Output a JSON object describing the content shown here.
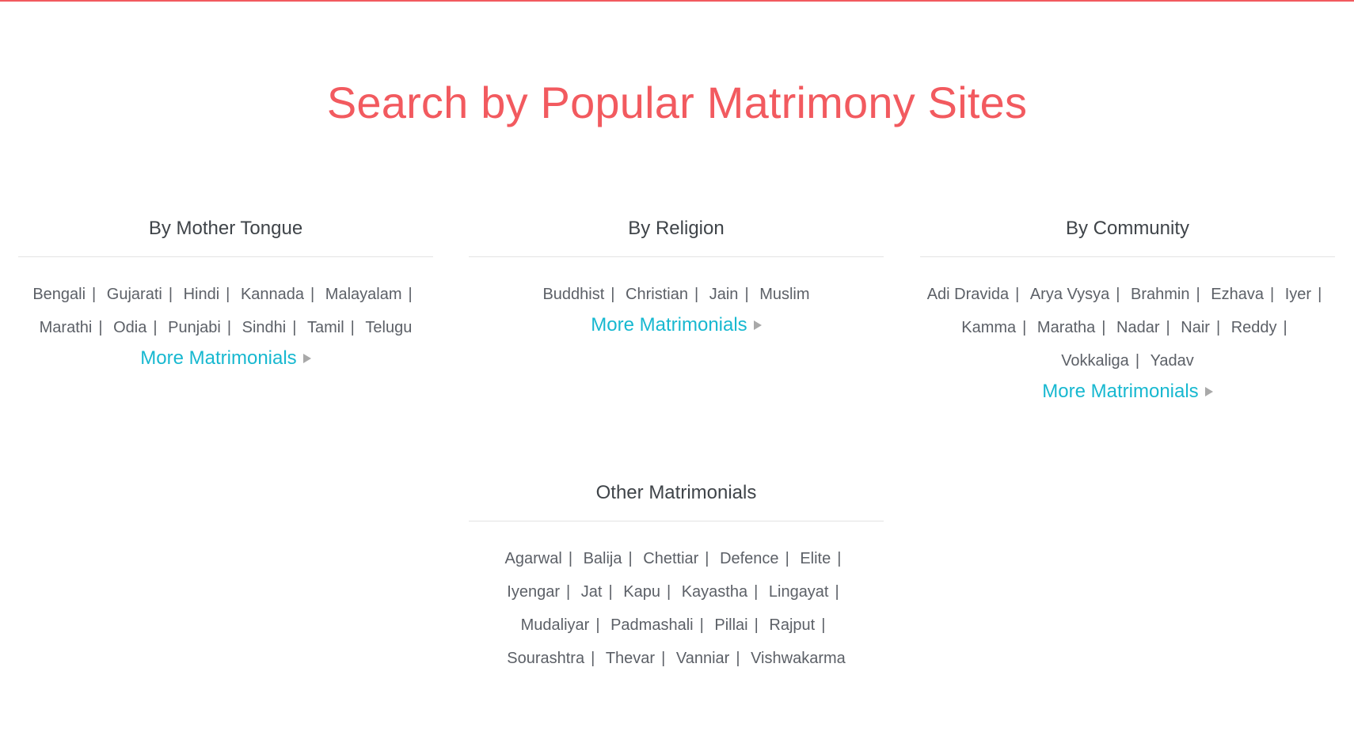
{
  "page": {
    "title": "Search by Popular Matrimony Sites",
    "accent_color": "#f25a5f",
    "link_color": "#17b8d0"
  },
  "sections": {
    "mother_tongue": {
      "heading": "By Mother Tongue",
      "links": [
        "Bengali",
        "Gujarati",
        "Hindi",
        "Kannada",
        "Malayalam",
        "Marathi",
        "Odia",
        "Punjabi",
        "Sindhi",
        "Tamil",
        "Telugu"
      ],
      "more_label": "More Matrimonials"
    },
    "religion": {
      "heading": "By Religion",
      "links": [
        "Buddhist",
        "Christian",
        "Jain",
        "Muslim"
      ],
      "more_label": "More Matrimonials"
    },
    "community": {
      "heading": "By Community",
      "links": [
        "Adi Dravida",
        "Arya Vysya",
        "Brahmin",
        "Ezhava",
        "Iyer",
        "Kamma",
        "Maratha",
        "Nadar",
        "Nair",
        "Reddy",
        "Vokkaliga",
        "Yadav"
      ],
      "more_label": "More Matrimonials"
    },
    "other": {
      "heading": "Other Matrimonials",
      "links": [
        "Agarwal",
        "Balija",
        "Chettiar",
        "Defence",
        "Elite",
        "Iyengar",
        "Jat",
        "Kapu",
        "Kayastha",
        "Lingayat",
        "Mudaliyar",
        "Padmashali",
        "Pillai",
        "Rajput",
        "Sourashtra",
        "Thevar",
        "Vanniar",
        "Vishwakarma"
      ]
    },
    "separator": "|"
  }
}
